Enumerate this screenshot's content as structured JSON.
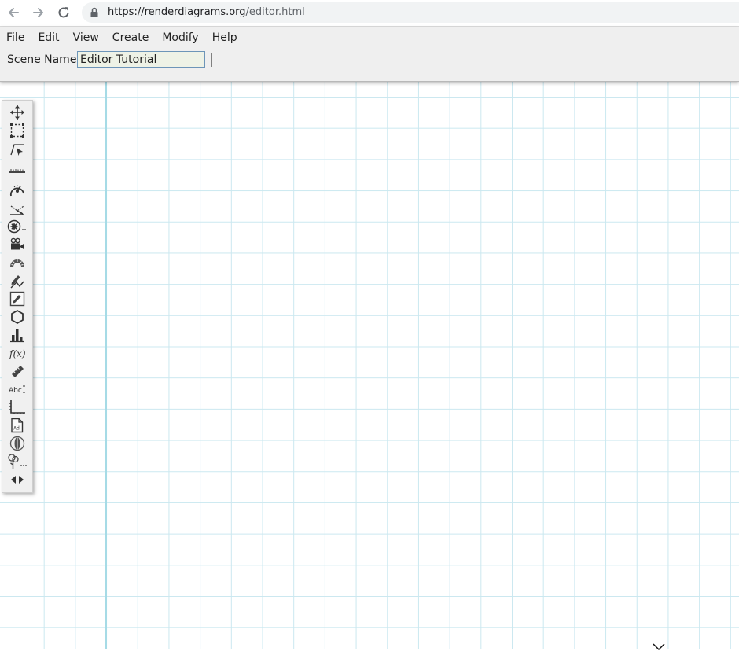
{
  "browser": {
    "url_host": "https://renderdiagrams.org",
    "url_path": "/editor.html",
    "back_icon": "arrow-left-icon",
    "forward_icon": "arrow-right-icon",
    "reload_icon": "reload-icon",
    "lock_icon": "lock-icon"
  },
  "menu": {
    "items": [
      "File",
      "Edit",
      "View",
      "Create",
      "Modify",
      "Help"
    ]
  },
  "scene": {
    "label": "Scene Name",
    "value": "Editor Tutorial"
  },
  "toolbox": {
    "tools": [
      "move-icon",
      "rectangle-select-icon",
      "pointer-select-icon",
      "ruler-tape-icon",
      "gauge-icon",
      "ray-icon",
      "gear-circle-icon",
      "video-camera-icon",
      "protractor-icon",
      "pencil-draw-icon",
      "pencil-box-icon",
      "hexagon-icon",
      "bar-chart-icon",
      "function-icon",
      "ruler-icon",
      "text-abc-icon",
      "axis-icon",
      "document-icon",
      "lens-icon",
      "tree-icon",
      "left-right-arrows-icon"
    ]
  },
  "colors": {
    "grid": "#cbe8f0",
    "axis": "#a6dbe6",
    "header_bg": "#efefef",
    "input_bg": "#eef2e6",
    "input_border": "#6d95b8"
  }
}
